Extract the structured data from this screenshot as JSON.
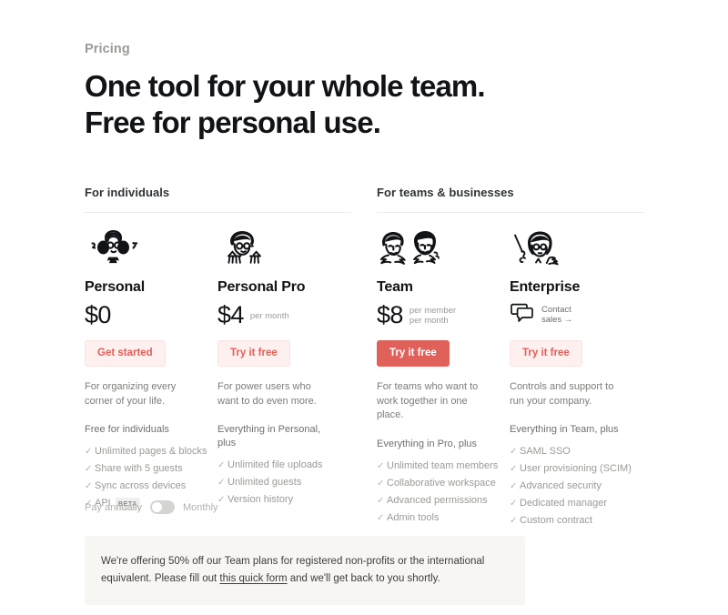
{
  "header": {
    "eyebrow": "Pricing",
    "headline_line1": "One tool for your whole team.",
    "headline_line2": "Free for personal use."
  },
  "colors": {
    "accent": "#e0605a",
    "accent_soft_bg": "#fdf0ee",
    "page_bg": "#ffffff",
    "notice_bg": "#f8f6f3",
    "muted_text": "#9b9a97",
    "heading_text": "#111316"
  },
  "groups": [
    {
      "title": "For individuals",
      "plans": [
        {
          "icon": "person-headphones-illustration",
          "name": "Personal",
          "price": "$0",
          "price_unit_lines": [],
          "cta": {
            "label": "Get started",
            "style": "soft"
          },
          "description": "For organizing every corner of your life.",
          "features_heading": "Free for individuals",
          "features": [
            {
              "label": "Unlimited pages & blocks",
              "badge": ""
            },
            {
              "label": "Share with 5 guests",
              "badge": ""
            },
            {
              "label": "Sync across devices",
              "badge": ""
            },
            {
              "label": "API",
              "badge": "BETA"
            }
          ]
        },
        {
          "icon": "person-writing-illustration",
          "name": "Personal Pro",
          "price": "$4",
          "price_unit_lines": [
            "per month"
          ],
          "cta": {
            "label": "Try it free",
            "style": "soft"
          },
          "description": "For power users who want to do even more.",
          "features_heading": "Everything in Personal, plus",
          "features": [
            {
              "label": "Unlimited file uploads",
              "badge": ""
            },
            {
              "label": "Unlimited guests",
              "badge": ""
            },
            {
              "label": "Version history",
              "badge": ""
            }
          ]
        }
      ]
    },
    {
      "title": "For teams & businesses",
      "plans": [
        {
          "icon": "two-people-illustration",
          "name": "Team",
          "price": "$8",
          "price_unit_lines": [
            "per member",
            "per month"
          ],
          "cta": {
            "label": "Try it free",
            "style": "solid"
          },
          "description": "For teams who want to work together in one place.",
          "features_heading": "Everything in Pro, plus",
          "features": [
            {
              "label": "Unlimited team members",
              "badge": ""
            },
            {
              "label": "Collaborative workspace",
              "badge": ""
            },
            {
              "label": "Advanced permissions",
              "badge": ""
            },
            {
              "label": "Admin tools",
              "badge": ""
            }
          ]
        },
        {
          "icon": "person-presenting-illustration",
          "name": "Enterprise",
          "price": "",
          "price_unit_lines": [],
          "contact": {
            "icon": "speech-bubbles-icon",
            "line1": "Contact",
            "line2": "sales →"
          },
          "cta": {
            "label": "Try it free",
            "style": "soft"
          },
          "description": "Controls and support to run your company.",
          "features_heading": "Everything in Team, plus",
          "features": [
            {
              "label": "SAML SSO",
              "badge": ""
            },
            {
              "label": "User provisioning (SCIM)",
              "badge": ""
            },
            {
              "label": "Advanced security",
              "badge": ""
            },
            {
              "label": "Dedicated manager",
              "badge": ""
            },
            {
              "label": "Custom contract",
              "badge": ""
            }
          ]
        }
      ]
    }
  ],
  "billing": {
    "annual_label": "Pay annually",
    "monthly_label": "Monthly",
    "toggle_state": "annual"
  },
  "notice": {
    "text_before": "We're offering 50% off our Team plans for registered non-profits or the international equivalent. Please fill out ",
    "link_text": "this quick form",
    "text_after": " and we'll get back to you shortly."
  },
  "check_glyph": "✓"
}
